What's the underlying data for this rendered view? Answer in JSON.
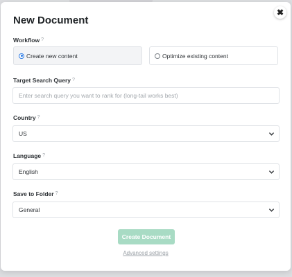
{
  "modal": {
    "title": "New Document",
    "close_icon": "close-icon"
  },
  "workflow": {
    "label": "Workflow",
    "help": "?",
    "options": [
      {
        "label": "Create new content",
        "selected": true
      },
      {
        "label": "Optimize existing content",
        "selected": false
      }
    ]
  },
  "query": {
    "label": "Target Search Query",
    "help": "?",
    "placeholder": "Enter search query you want to rank for (long-tail works best)",
    "value": ""
  },
  "country": {
    "label": "Country",
    "help": "?",
    "value": "US"
  },
  "language": {
    "label": "Language",
    "help": "?",
    "value": "English"
  },
  "folder": {
    "label": "Save to Folder",
    "help": "?",
    "value": "General"
  },
  "actions": {
    "create_label": "Create Document",
    "advanced_label": "Advanced settings"
  },
  "colors": {
    "primary_disabled": "#a8dbc4",
    "radio_accent": "#2c7be5"
  }
}
